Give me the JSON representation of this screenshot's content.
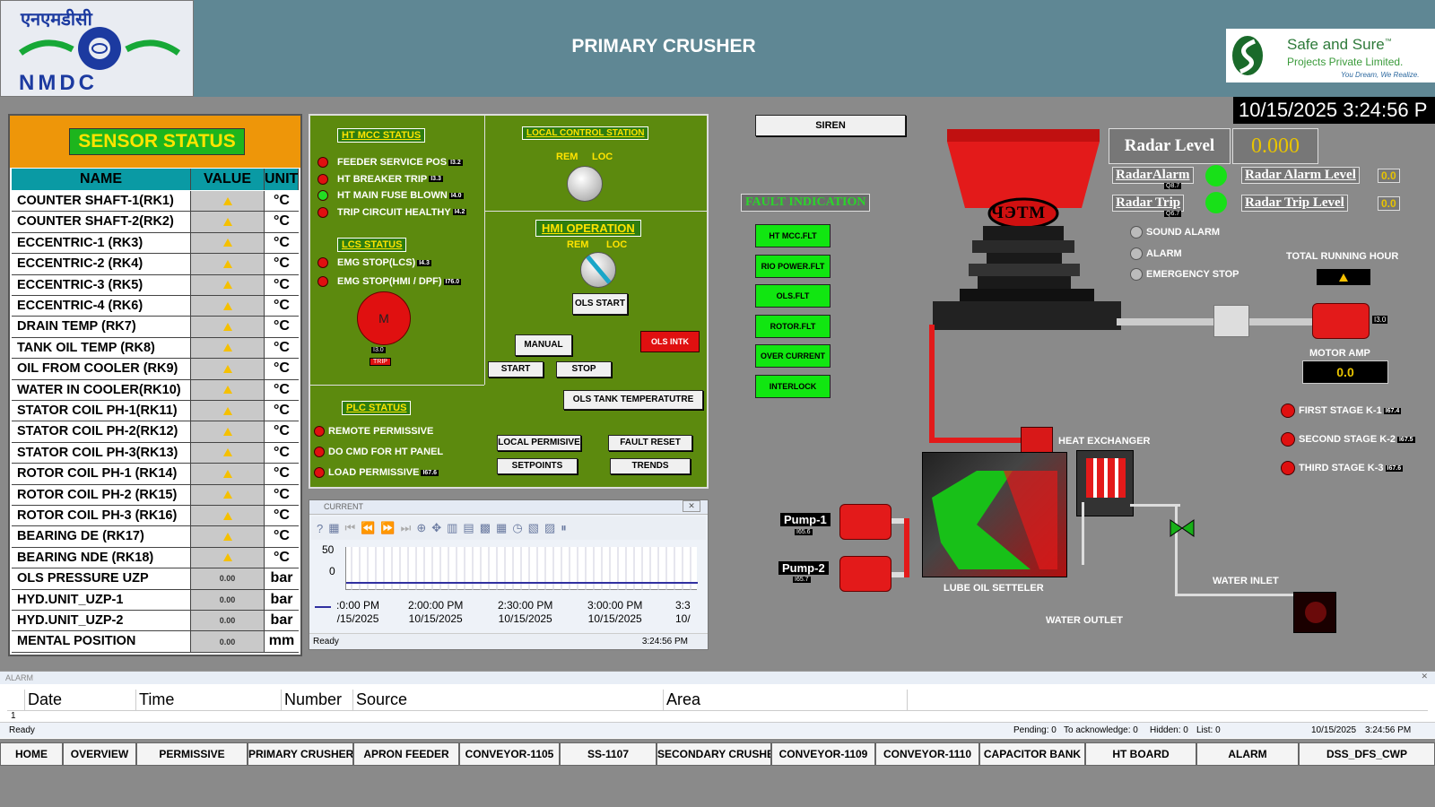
{
  "header": {
    "title": "PRIMARY CRUSHER",
    "logo_left_text": "एनएमडीसी",
    "logo_left_brand": "NMDC",
    "logo_right_title": "Safe and Sure",
    "logo_right_tm": "™",
    "logo_right_sub": "Projects Private Limited.",
    "logo_right_tag": "You Dream, We Realize.",
    "datetime": "10/15/2025 3:24:56 P"
  },
  "sensor": {
    "title": "SENSOR STATUS",
    "col_name": "NAME",
    "col_value": "VALUE",
    "col_unit": "UNIT",
    "rows": [
      {
        "name": "COUNTER SHAFT-1(RK1)",
        "value": "",
        "unit": "°C"
      },
      {
        "name": "COUNTER SHAFT-2(RK2)",
        "value": "",
        "unit": "°C"
      },
      {
        "name": "ECCENTRIC-1       (RK3)",
        "value": "",
        "unit": "°C"
      },
      {
        "name": "ECCENTRIC-2       (RK4)",
        "value": "",
        "unit": "°C"
      },
      {
        "name": "ECCENTRIC-3       (RK5)",
        "value": "",
        "unit": "°C"
      },
      {
        "name": "ECCENTRIC-4       (RK6)",
        "value": "",
        "unit": "°C"
      },
      {
        "name": "DRAIN  TEMP     (RK7)",
        "value": "",
        "unit": "°C"
      },
      {
        "name": "TANK OIL  TEMP    (RK8)",
        "value": "",
        "unit": "°C"
      },
      {
        "name": "OIL FROM COOLER (RK9)",
        "value": "",
        "unit": "°C"
      },
      {
        "name": "WATER IN COOLER(RK10)",
        "value": "",
        "unit": "°C"
      },
      {
        "name": "STATOR COIL PH-1(RK11)",
        "value": "",
        "unit": "°C"
      },
      {
        "name": "STATOR COIL PH-2(RK12)",
        "value": "",
        "unit": "°C"
      },
      {
        "name": "STATOR COIL PH-3(RK13)",
        "value": "",
        "unit": "°C"
      },
      {
        "name": "ROTOR COIL PH-1  (RK14)",
        "value": "",
        "unit": "°C"
      },
      {
        "name": "ROTOR COIL PH-2  (RK15)",
        "value": "",
        "unit": "°C"
      },
      {
        "name": "ROTOR COIL PH-3  (RK16)",
        "value": "",
        "unit": "°C"
      },
      {
        "name": "BEARING DE  (RK17)",
        "value": "",
        "unit": "°C"
      },
      {
        "name": "BEARING NDE (RK18)",
        "value": "",
        "unit": "°C"
      },
      {
        "name": "OLS PRESSURE   UZP",
        "value": "0.00",
        "unit": "bar"
      },
      {
        "name": "HYD.UNIT_UZP-1",
        "value": "0.00",
        "unit": "bar"
      },
      {
        "name": "HYD.UNIT_UZP-2",
        "value": "0.00",
        "unit": "bar"
      },
      {
        "name": "MENTAL POSITION",
        "value": "0.00",
        "unit": "mm"
      }
    ]
  },
  "ht_mcc": {
    "title": "HT MCC STATUS",
    "items": [
      {
        "label": "FEEDER SERVICE POS",
        "tag": "I3.2",
        "state": "red"
      },
      {
        "label": "HT BREAKER TRIP",
        "tag": "I3.3",
        "state": "red"
      },
      {
        "label": "HT MAIN FUSE BLOWN",
        "tag": "I4.0",
        "state": "green"
      },
      {
        "label": "TRIP CIRCUIT HEALTHY",
        "tag": "I4.2",
        "state": "red"
      }
    ]
  },
  "lcs": {
    "title": "LCS STATUS",
    "items": [
      {
        "label": "EMG STOP(LCS)",
        "tag": "I4.3",
        "state": "red"
      },
      {
        "label": "EMG STOP(HMI / DPF)",
        "tag": "I76.0",
        "state": "red"
      }
    ],
    "motor_label": "M",
    "motor_tag": "I3.0",
    "trip_label": "TRIP"
  },
  "local_control": {
    "title": "LOCAL CONTROL STATION",
    "rem": "REM",
    "loc": "LOC"
  },
  "hmi": {
    "title": "HMI OPERATION",
    "rem": "REM",
    "loc": "LOC",
    "ols_start": "OLS START",
    "manual": "MANUAL",
    "ols_intk": "OLS INTK",
    "start": "START",
    "stop": "STOP",
    "ols_tank": "OLS TANK TEMPERATUTRE",
    "local_permissive": "LOCAL PERMISIVE",
    "fault_reset": "FAULT RESET",
    "setpoints": "SETPOINTS",
    "trends": "TRENDS"
  },
  "plc": {
    "title": "PLC STATUS",
    "items": [
      {
        "label": "REMOTE PERMISSIVE",
        "tag": ""
      },
      {
        "label": "DO CMD FOR HT PANEL",
        "tag": ""
      },
      {
        "label": "LOAD PERMISSIVE",
        "tag": "I67.6"
      }
    ]
  },
  "trend": {
    "title": "CURRENT",
    "status": "Ready",
    "time": "3:24:56 PM",
    "yticks": [
      "50",
      "0"
    ],
    "xticks": [
      {
        "t": ":0:00 PM",
        "d": "/15/2025"
      },
      {
        "t": "2:00:00 PM",
        "d": "10/15/2025"
      },
      {
        "t": "2:30:00 PM",
        "d": "10/15/2025"
      },
      {
        "t": "3:00:00 PM",
        "d": "10/15/2025"
      },
      {
        "t": "3:3",
        "d": "10/"
      }
    ]
  },
  "siren": "SIREN",
  "fault": {
    "title": "FAULT INDICATION",
    "items": [
      "HT MCC.FLT",
      "RIO POWER.FLT",
      "OLS.FLT",
      "ROTOR.FLT",
      "OVER CURRENT",
      "INTERLOCK"
    ]
  },
  "radar": {
    "title": "Radar Level",
    "value": "0.000",
    "alarm": "RadarAlarm",
    "alarm_tag": "Q8.7",
    "trip": "Radar Trip",
    "trip_tag": "Q6.7",
    "alarm_level": "Radar Alarm Level",
    "alarm_level_val": "0.0",
    "trip_level": "Radar Trip Level",
    "trip_level_val": "0.0"
  },
  "status_lights": [
    "SOUND ALARM",
    "ALARM",
    "EMERGENCY STOP"
  ],
  "total_running_hour": "TOTAL RUNNING HOUR",
  "motor": {
    "tag": "I3.0",
    "amp_label": "MOTOR AMP",
    "amp_value": "0.0"
  },
  "stages": [
    {
      "label": "FIRST STAGE K-1",
      "tag": "I67.4"
    },
    {
      "label": "SECOND STAGE K-2",
      "tag": "I67.5"
    },
    {
      "label": "THIRD STAGE K-3",
      "tag": "I67.6"
    }
  ],
  "process": {
    "crusher_logo": "ЧЭТМ",
    "heat_exchanger": "HEAT EXCHANGER",
    "lube_oil": "LUBE OIL SETTELER",
    "water_outlet": "WATER OUTLET",
    "water_inlet": "WATER INLET",
    "pump1": "Pump-1",
    "pump1_tag": "I65.6",
    "pump2": "Pump-2",
    "pump2_tag": "I65.7"
  },
  "alarm": {
    "title": "ALARM",
    "cols": [
      "",
      "Date",
      "Time",
      "Number",
      "Source",
      "Area"
    ],
    "row_num": "1",
    "status": "Ready",
    "pending": "Pending: 0",
    "to_ack": "To acknowledge: 0",
    "hidden": "Hidden: 0",
    "list": "List: 0",
    "date": "10/15/2025",
    "time": "3:24:56 PM"
  },
  "nav": [
    "HOME",
    "OVERVIEW",
    "PERMISSIVE",
    "PRIMARY CRUSHER",
    "APRON FEEDER",
    "CONVEYOR-1105",
    "SS-1107",
    "SECONDARY CRUSHER",
    "CONVEYOR-1109",
    "CONVEYOR-1110",
    "CAPACITOR BANK",
    "HT BOARD",
    "ALARM",
    "DSS_DFS_CWP"
  ],
  "colors": {
    "header": "#5f8794",
    "panel_green": "#5c8a0e",
    "fault_green": "#11e611",
    "sensor_orange": "#ee9609",
    "sensor_teal": "#0a9aa4",
    "alarm_red": "#e01010"
  }
}
